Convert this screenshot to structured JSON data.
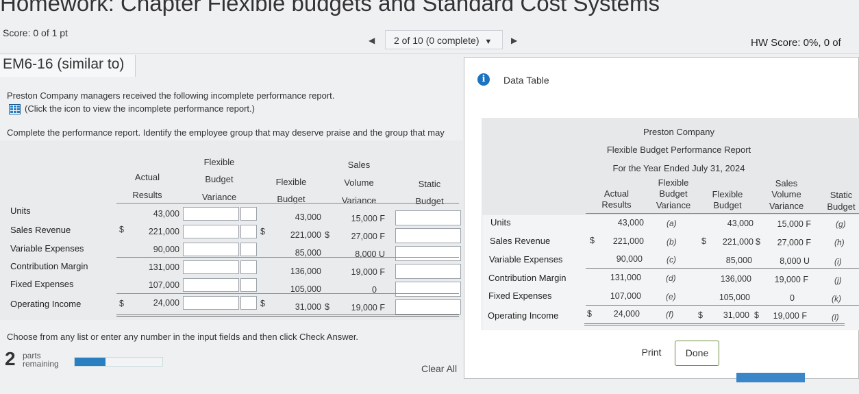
{
  "page": {
    "title": "Homework: Chapter Flexible budgets and Standard Cost Systems",
    "score": "Score: 0 of 1 pt",
    "nav": {
      "position": "2 of 10 (0 complete)",
      "dropdown_glyph": "▼",
      "prev_glyph": "◀",
      "next_glyph": "▶"
    },
    "hw_score": "HW Score: 0%, 0 of",
    "question_id": "EM6-16 (similar to)"
  },
  "question": {
    "text1": "Preston Company managers received the following incomplete performance report.",
    "text2": "(Click the icon to view the incomplete performance report.)",
    "text3": "Complete the performance report. Identify the employee group that may deserve praise and the group that may",
    "footer": "Choose from any list or enter any number in the input fields and then click Check Answer.",
    "parts_count": "2",
    "parts_label_1": "parts",
    "parts_label_2": "remaining",
    "progress_fraction": 0.35,
    "clear_all": "Clear All"
  },
  "answer_table": {
    "headers": {
      "actual_1": "Actual",
      "actual_2": "Results",
      "fbv_1": "Flexible",
      "fbv_2": "Budget",
      "fbv_3": "Variance",
      "fb_1": "Flexible",
      "fb_2": "Budget",
      "svv_1": "Sales",
      "svv_2": "Volume",
      "svv_3": "Variance",
      "static_1": "Static",
      "static_2": "Budget"
    },
    "rows": [
      {
        "label": "Units",
        "actual_dollar": "",
        "actual": "43,000",
        "fb_dollar": "",
        "fb": "43,000",
        "svv_dollar": "",
        "svv": "15,000 F"
      },
      {
        "label": "Sales Revenue",
        "actual_dollar": "$",
        "actual": "221,000",
        "fb_dollar": "$",
        "fb": "221,000",
        "svv_dollar": "$",
        "svv": "27,000 F"
      },
      {
        "label": "Variable Expenses",
        "actual_dollar": "",
        "actual": "90,000",
        "fb_dollar": "",
        "fb": "85,000",
        "svv_dollar": "",
        "svv": "8,000 U"
      },
      {
        "label": "Contribution Margin",
        "actual_dollar": "",
        "actual": "131,000",
        "fb_dollar": "",
        "fb": "136,000",
        "svv_dollar": "",
        "svv": "19,000 F"
      },
      {
        "label": "Fixed Expenses",
        "actual_dollar": "",
        "actual": "107,000",
        "fb_dollar": "",
        "fb": "105,000",
        "svv_dollar": "",
        "svv": "0"
      },
      {
        "label": "Operating Income",
        "actual_dollar": "$",
        "actual": "24,000",
        "fb_dollar": "$",
        "fb": "31,000",
        "svv_dollar": "$",
        "svv": "19,000 F"
      }
    ]
  },
  "data_table": {
    "modal_title": "Data Table",
    "info_glyph": "i",
    "company": "Preston Company",
    "report_title": "Flexible Budget Performance Report",
    "period": "For the Year Ended July 31, 2024",
    "headers": {
      "actual_1": "Actual",
      "actual_2": "Results",
      "fbv_1": "Flexible",
      "fbv_2": "Budget",
      "fbv_3": "Variance",
      "fb_1": "Flexible",
      "fb_2": "Budget",
      "svv_1": "Sales",
      "svv_2": "Volume",
      "svv_3": "Variance",
      "static_1": "Static",
      "static_2": "Budget"
    },
    "rows": [
      {
        "label": "Units",
        "actual_dollar": "",
        "actual": "43,000",
        "fbv": "(a)",
        "fb_dollar": "",
        "fb": "43,000",
        "svv_dollar": "",
        "svv": "15,000 F",
        "static": "(g)"
      },
      {
        "label": "Sales Revenue",
        "actual_dollar": "$",
        "actual": "221,000",
        "fbv": "(b)",
        "fb_dollar": "$",
        "fb": "221,000",
        "svv_dollar": "$",
        "svv": "27,000 F",
        "static": "(h)"
      },
      {
        "label": "Variable Expenses",
        "actual_dollar": "",
        "actual": "90,000",
        "fbv": "(c)",
        "fb_dollar": "",
        "fb": "85,000",
        "svv_dollar": "",
        "svv": "8,000 U",
        "static": "(i)"
      },
      {
        "label": "Contribution Margin",
        "actual_dollar": "",
        "actual": "131,000",
        "fbv": "(d)",
        "fb_dollar": "",
        "fb": "136,000",
        "svv_dollar": "",
        "svv": "19,000 F",
        "static": "(j)"
      },
      {
        "label": "Fixed Expenses",
        "actual_dollar": "",
        "actual": "107,000",
        "fbv": "(e)",
        "fb_dollar": "",
        "fb": "105,000",
        "svv_dollar": "",
        "svv": "0",
        "static": "(k)"
      },
      {
        "label": "Operating Income",
        "actual_dollar": "$",
        "actual": "24,000",
        "fbv": "(f)",
        "fb_dollar": "$",
        "fb": "31,000",
        "svv_dollar": "$",
        "svv": "19,000 F",
        "static": "(l)"
      }
    ],
    "print_label": "Print",
    "done_label": "Done"
  }
}
